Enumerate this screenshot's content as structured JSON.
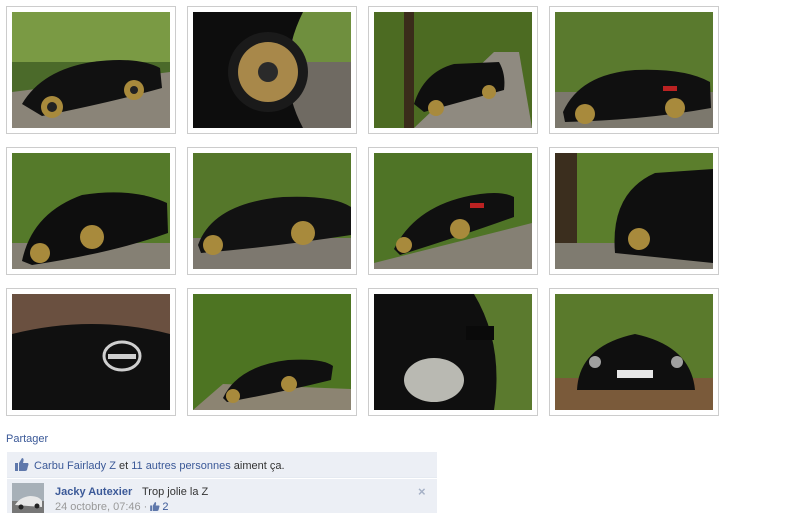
{
  "photos": [
    {
      "id": "photo-1",
      "description": "black Nissan 350Z parked on forest road"
    },
    {
      "id": "photo-2",
      "description": "close-up of bronze wheel"
    },
    {
      "id": "photo-3",
      "description": "rear view of car on forest road"
    },
    {
      "id": "photo-4",
      "description": "rear three-quarter view"
    },
    {
      "id": "photo-5",
      "description": "front three-quarter view in forest"
    },
    {
      "id": "photo-6",
      "description": "side view with trees"
    },
    {
      "id": "photo-7",
      "description": "rear view on sloped road"
    },
    {
      "id": "photo-8",
      "description": "front view near tree trunk"
    },
    {
      "id": "photo-9",
      "description": "close-up of Nissan badge on hood"
    },
    {
      "id": "photo-10",
      "description": "car among autumn leaves"
    },
    {
      "id": "photo-11",
      "description": "close-up of headlight and mirror"
    },
    {
      "id": "photo-12",
      "description": "front view on leafy road"
    }
  ],
  "share": {
    "label": "Partager"
  },
  "likes": {
    "friend_link": "Carbu Fairlady Z",
    "connector": " et ",
    "others_link": "11 autres personnes",
    "suffix": " aiment ça."
  },
  "comment": {
    "author": "Jacky Autexier",
    "text": "Trop jolie la Z",
    "timestamp": "24 octobre, 07:46",
    "separator": " · ",
    "like_count": "2",
    "close_label": "×"
  },
  "colors": {
    "link": "#3b5998",
    "bar_bg": "#eceff5",
    "border": "#cccccc"
  }
}
